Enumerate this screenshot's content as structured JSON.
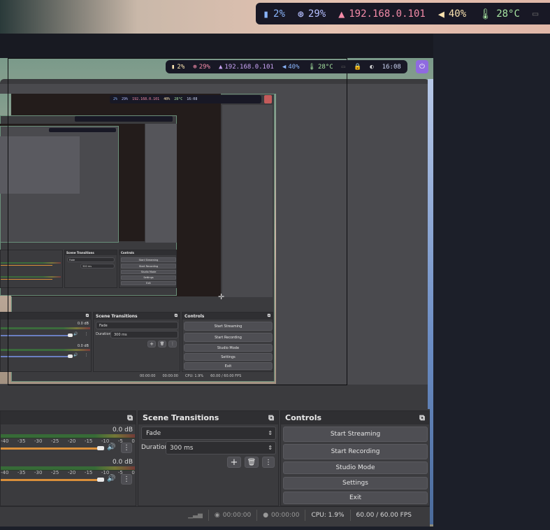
{
  "statusbar": {
    "battery": "2%",
    "cpu": "29%",
    "ip": "192.168.0.101",
    "volume": "40%",
    "temperature": "28°C",
    "clock": "16:08"
  },
  "colors": {
    "battery": "#89b4fa",
    "cpu": "#b4befe",
    "ip": "#f38ba8",
    "volume": "#f9e2af",
    "temperature": "#a6e3a1",
    "power_bg": "#8f6ae0"
  },
  "mixer": {
    "channels": [
      {
        "db": "0.0 dB"
      },
      {
        "db": "0.0 dB"
      }
    ],
    "ticks": [
      "0",
      "-5",
      "-10",
      "-15",
      "-20",
      "-25",
      "-30",
      "-35",
      "-40"
    ]
  },
  "transitions": {
    "title": "Scene Transitions",
    "selected": "Fade",
    "duration_label": "Duration",
    "duration_value": "300 ms"
  },
  "controls": {
    "title": "Controls",
    "buttons": [
      "Start Streaming",
      "Start Recording",
      "Studio Mode",
      "Settings",
      "Exit"
    ]
  },
  "status": {
    "stream_time": "00:00:00",
    "record_time": "00:00:00",
    "cpu": "CPU: 1.9%",
    "fps": "60.00 / 60.00 FPS"
  },
  "mid": {
    "transitions_title": "Scene Transitions",
    "controls_title": "Controls",
    "selected": "Fade",
    "duration_label": "Duration",
    "duration_value": "300 ms",
    "db": "0.0 dB",
    "cpu": "CPU: 1.9%",
    "fps": "60.00 / 60.00 FPS",
    "time": "00:00:00"
  }
}
